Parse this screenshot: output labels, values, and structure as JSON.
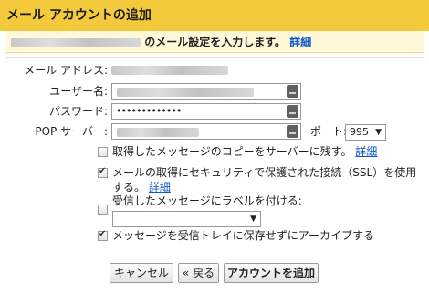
{
  "dialog": {
    "title": "メール アカウントの追加",
    "intro_suffix": "のメール設定を入力します。",
    "intro_link": "詳細"
  },
  "form": {
    "email_label": "メール アドレス:",
    "username_label": "ユーザー名:",
    "password_label": "パスワード:",
    "password_value": "•••••••••••••",
    "pop_label": "POP サーバー:",
    "port_label": "ポート:",
    "port_value": "995"
  },
  "options": [
    {
      "label": "取得したメッセージのコピーをサーバーに残す。",
      "link": "詳細",
      "checked": false
    },
    {
      "label": "メールの取得にセキュリティで保護された接続（SSL）を使用する。",
      "link": "詳細",
      "checked": true
    },
    {
      "label": "受信したメッセージにラベルを付ける:",
      "checked": false
    },
    {
      "label": "メッセージを受信トレイに保存せずにアーカイブする",
      "checked": true
    }
  ],
  "buttons": {
    "cancel": "キャンセル",
    "back": "« 戻る",
    "add": "アカウントを追加"
  },
  "icons": {
    "field_key": "keyboard-key-icon",
    "dropdown": "triangle-down-icon"
  }
}
